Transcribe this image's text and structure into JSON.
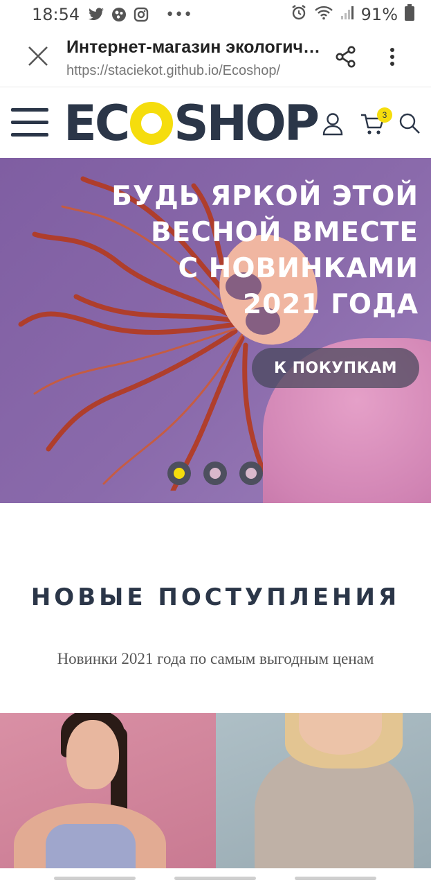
{
  "status_bar": {
    "time": "18:54",
    "battery": "91%",
    "icons": [
      "twitter-icon",
      "app-icon",
      "instagram-icon",
      "more-dots-icon",
      "alarm-icon",
      "wifi-icon",
      "signal-icon",
      "battery-icon"
    ]
  },
  "browser": {
    "title": "Интернет-магазин экологичн…",
    "url": "https://staciekot.github.io/Ecoshop/"
  },
  "header": {
    "logo_left": "EC",
    "logo_right": "SHOP",
    "cart_count": "3",
    "accent": "#f5dd0d",
    "brand_color": "#2b3648"
  },
  "hero": {
    "title": "БУДЬ ЯРКОЙ ЭТОЙ\nВЕСНОЙ ВМЕСТЕ\nС НОВИНКАМИ\n2021 ГОДА",
    "cta_label": "К ПОКУПКАМ",
    "slides_count": 3,
    "active_slide": 1
  },
  "section": {
    "title": "НОВЫЕ ПОСТУПЛЕНИЯ",
    "subtitle": "Новинки 2021 года по самым выгодным ценам"
  }
}
